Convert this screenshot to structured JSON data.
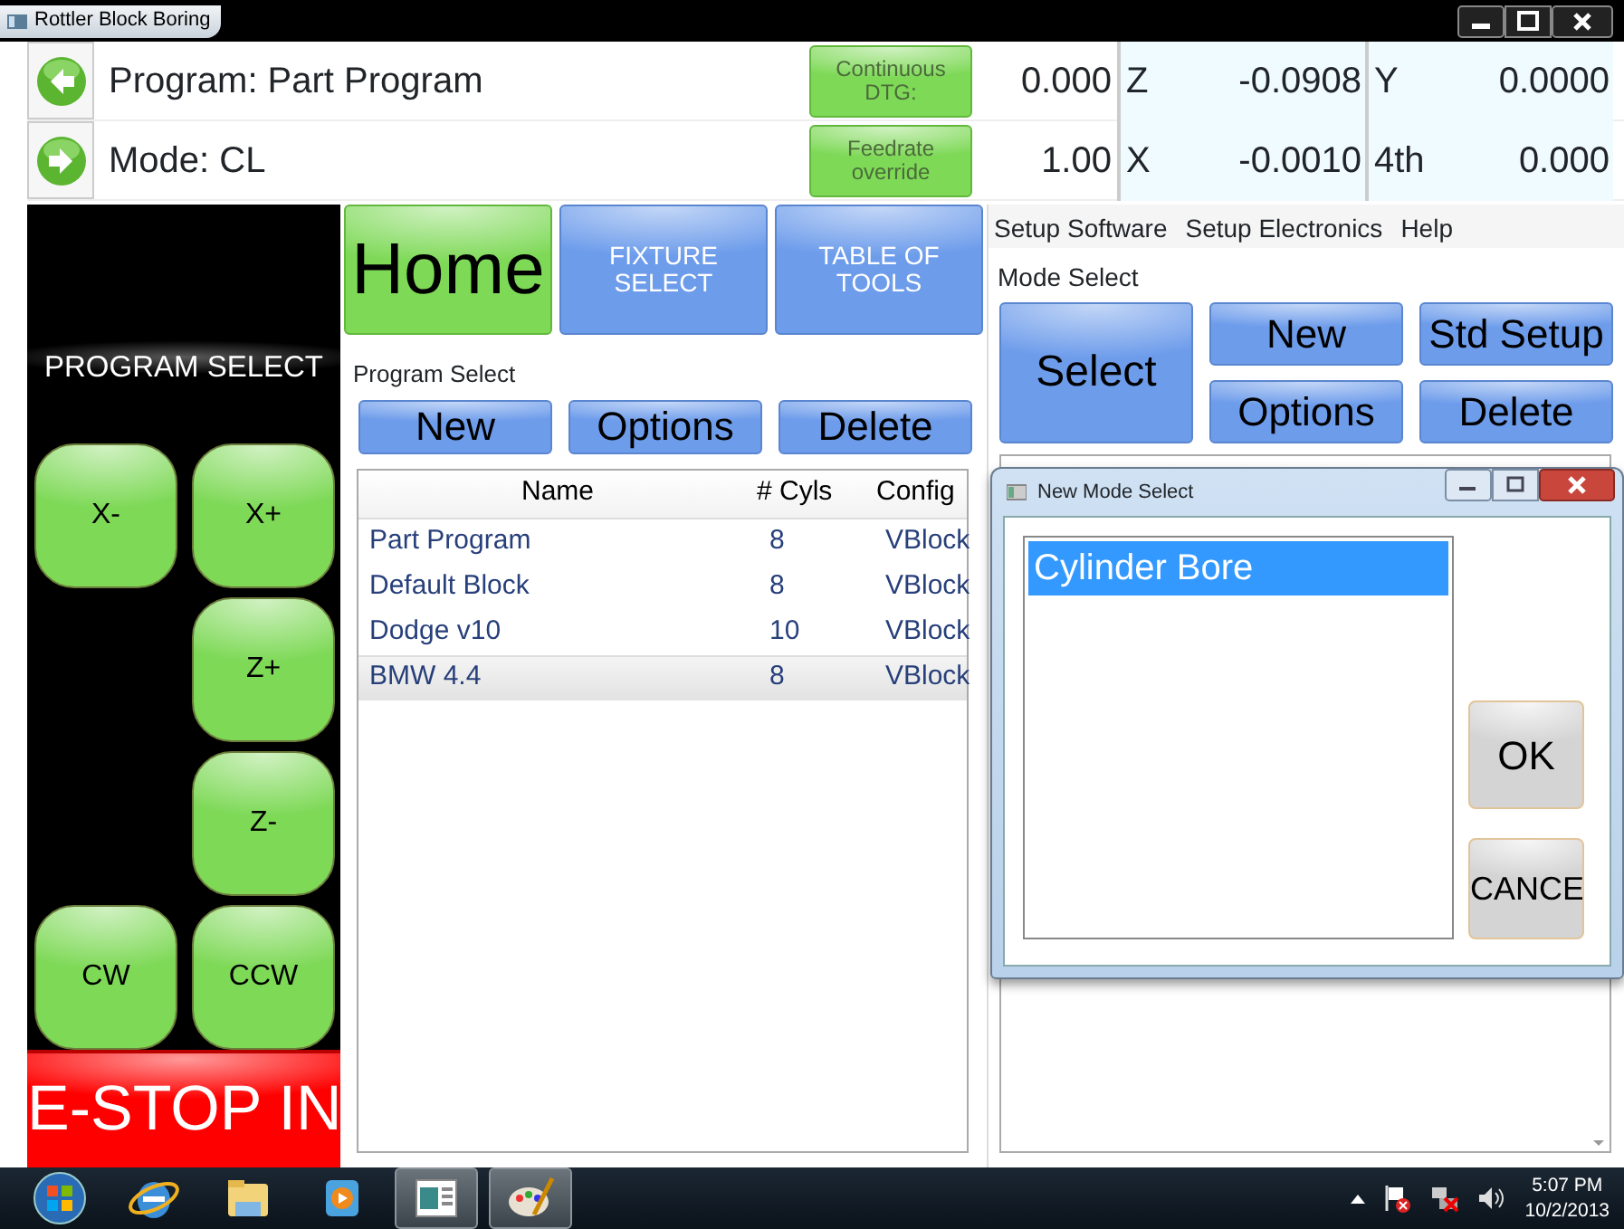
{
  "window": {
    "title": "Rottler Block Boring"
  },
  "header": {
    "rows": [
      {
        "text": "Program: Part Program",
        "button": "Continuous DTG:",
        "value": "0.000",
        "axes": [
          {
            "axis": "Z",
            "value": "-0.0908"
          },
          {
            "axis": "Y",
            "value": "0.0000"
          }
        ]
      },
      {
        "text": "Mode: CL",
        "button": "Feedrate override",
        "value": "1.00",
        "axes": [
          {
            "axis": "X",
            "value": "-0.0010"
          },
          {
            "axis": "4th",
            "value": "0.000"
          }
        ]
      }
    ]
  },
  "jog_panel": {
    "title": "PROGRAM SELECT",
    "rows": [
      {
        "left": "X-",
        "right": "X+"
      },
      {
        "right": "Z+"
      },
      {
        "right": "Z-"
      },
      {
        "left": "CW",
        "right": "CCW"
      }
    ],
    "estop": "E-STOP IN"
  },
  "tabs": [
    {
      "label": "Home",
      "selected": true
    },
    {
      "label": "FIXTURE SELECT",
      "selected": false
    },
    {
      "label": "TABLE OF TOOLS",
      "selected": false
    }
  ],
  "program_select": {
    "title": "Program Select",
    "buttons": [
      "New",
      "Options",
      "Delete"
    ],
    "table": {
      "columns": [
        "Name",
        "# Cyls",
        "Config"
      ],
      "rows": [
        {
          "cells": [
            "Part Program",
            "8",
            "VBlock"
          ],
          "selected": false
        },
        {
          "cells": [
            "Default Block",
            "8",
            "VBlock"
          ],
          "selected": false
        },
        {
          "cells": [
            "Dodge v10",
            "10",
            "VBlock"
          ],
          "selected": false
        },
        {
          "cells": [
            "BMW 4.4",
            "8",
            "VBlock"
          ],
          "selected": true
        }
      ]
    }
  },
  "menu": [
    "Setup Software",
    "Setup Electronics",
    "Help"
  ],
  "mode_select": {
    "title": "Mode Select",
    "buttons": [
      "Select",
      "New",
      "Std Setup",
      "Options",
      "Delete"
    ]
  },
  "dialog": {
    "title": "New Mode Select",
    "items": [
      {
        "label": "Cylinder Bore",
        "selected": true
      }
    ],
    "buttons": [
      "OK",
      "CANCE"
    ]
  },
  "taskbar": {
    "time": "5:07 PM",
    "date": "10/2/2013"
  }
}
